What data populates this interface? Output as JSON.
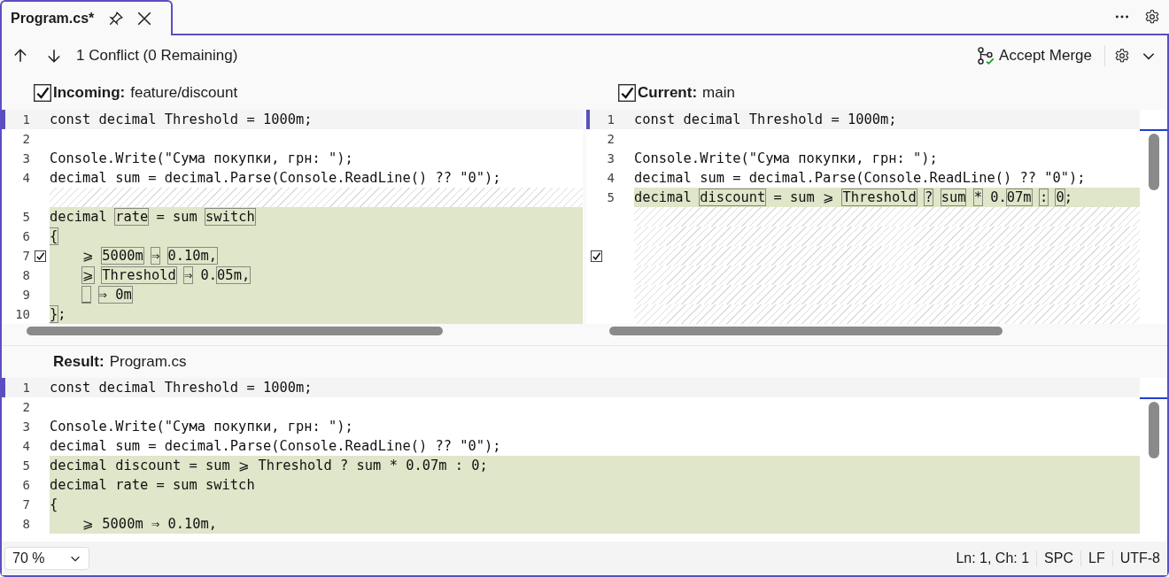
{
  "tab": {
    "title": "Program.cs*"
  },
  "toolbar": {
    "status": "1 Conflict (0 Remaining)",
    "accept_label": "Accept Merge"
  },
  "incoming": {
    "label": "Incoming:",
    "branch": "feature/discount",
    "checked": true,
    "lines": [
      {
        "kind": "current",
        "num": "1",
        "text": "const decimal Threshold = 1000m;"
      },
      {
        "kind": "plain",
        "num": "2"
      },
      {
        "kind": "plain",
        "num": "3",
        "text": "Console.Write(\"Сума покупки, грн: \");"
      },
      {
        "kind": "plain",
        "num": "4",
        "text": "decimal sum = decimal.Parse(Console.ReadLine() ?? \"0\");"
      },
      {
        "kind": "spacer"
      },
      {
        "kind": "changed",
        "num": "5",
        "segments": [
          {
            "text": "decimal ",
            "boxed": false,
            "space_before": false
          },
          {
            "text": "rate",
            "boxed": true,
            "space_before": false
          },
          {
            "text": " = sum ",
            "boxed": false,
            "space_before": false
          },
          {
            "text": "switch",
            "boxed": true,
            "space_before": false
          }
        ]
      },
      {
        "kind": "changed",
        "num": "6",
        "segments": [
          {
            "text": "{",
            "boxed": true,
            "space_before": false
          }
        ]
      },
      {
        "kind": "changed",
        "num": "7",
        "checkbox": {
          "checked": true
        },
        "segments": [
          {
            "text": "    ⩾ ",
            "boxed": false,
            "space_before": false
          },
          {
            "text": "5000m",
            "boxed": true,
            "space_before": false
          },
          {
            "text": "⇒",
            "boxed": true,
            "space_before": true
          },
          {
            "text": "0.10m,",
            "boxed": true,
            "space_before": true
          }
        ]
      },
      {
        "kind": "changed",
        "num": "8",
        "indented": true,
        "segments": [
          {
            "text": "⩾",
            "boxed": true,
            "space_before": false
          },
          {
            "text": "Threshold",
            "boxed": true,
            "space_before": true
          },
          {
            "text": "⇒",
            "boxed": true,
            "space_before": true
          },
          {
            "text": " 0.",
            "boxed": false,
            "space_before": false
          },
          {
            "text": "05m,",
            "boxed": true,
            "space_before": false
          }
        ]
      },
      {
        "kind": "changed",
        "num": "9",
        "indented": true,
        "segments": [
          {
            "text": "_",
            "boxed": true,
            "space_before": false
          },
          {
            "text": "⇒ 0m",
            "boxed": true,
            "space_before": true
          }
        ]
      },
      {
        "kind": "changed",
        "num": "10",
        "segments": [
          {
            "text": "}",
            "boxed": true,
            "space_before": false
          },
          {
            "text": ";",
            "boxed": false,
            "space_before": false
          }
        ]
      }
    ]
  },
  "current": {
    "label": "Current:",
    "branch": "main",
    "checked": true,
    "lines": [
      {
        "kind": "current",
        "num": "1",
        "text": "const decimal Threshold = 1000m;"
      },
      {
        "kind": "plain",
        "num": "2"
      },
      {
        "kind": "plain",
        "num": "3",
        "text": "Console.Write(\"Сума покупки, грн: \");"
      },
      {
        "kind": "plain",
        "num": "4",
        "text": "decimal sum = decimal.Parse(Console.ReadLine() ?? \"0\");"
      },
      {
        "kind": "changed",
        "num": "5",
        "segments": [
          {
            "text": "decimal ",
            "boxed": false,
            "space_before": false
          },
          {
            "text": "discount",
            "boxed": true,
            "space_before": false
          },
          {
            "text": " = sum ⩾ ",
            "boxed": false,
            "space_before": false
          },
          {
            "text": "Threshold",
            "boxed": true,
            "space_before": false
          },
          {
            "text": "?",
            "boxed": true,
            "space_before": true
          },
          {
            "text": "sum",
            "boxed": true,
            "space_before": true
          },
          {
            "text": "*",
            "boxed": true,
            "space_before": true
          },
          {
            "text": " 0.",
            "boxed": false,
            "space_before": false
          },
          {
            "text": "07m",
            "boxed": true,
            "space_before": false
          },
          {
            "text": ":",
            "boxed": true,
            "space_before": true
          },
          {
            "text": "0",
            "boxed": true,
            "space_before": true
          },
          {
            "text": ";",
            "boxed": false,
            "space_before": false
          }
        ]
      },
      {
        "kind": "spacer"
      },
      {
        "kind": "spacer"
      },
      {
        "kind": "spacer",
        "checkbox": {
          "checked": true
        }
      },
      {
        "kind": "spacer"
      },
      {
        "kind": "spacer"
      },
      {
        "kind": "spacer"
      }
    ]
  },
  "result": {
    "label": "Result:",
    "file": "Program.cs",
    "lines": [
      {
        "kind": "current",
        "num": "1",
        "text": "const decimal Threshold = 1000m;"
      },
      {
        "kind": "plain",
        "num": "2"
      },
      {
        "kind": "plain",
        "num": "3",
        "text": "Console.Write(\"Сума покупки, грн: \");"
      },
      {
        "kind": "plain",
        "num": "4",
        "text": "decimal sum = decimal.Parse(Console.ReadLine() ?? \"0\");"
      },
      {
        "kind": "changed",
        "num": "5",
        "text": "decimal discount = sum ⩾ Threshold ? sum * 0.07m : 0;"
      },
      {
        "kind": "changed",
        "num": "6",
        "text": "decimal rate = sum switch"
      },
      {
        "kind": "changed",
        "num": "7",
        "text": "{"
      },
      {
        "kind": "changed",
        "num": "8",
        "text": "    ⩾ 5000m ⇒ 0.10m,"
      }
    ]
  },
  "status_bar": {
    "zoom": "70 %",
    "position": "Ln: 1, Ch: 1",
    "indent": "SPC",
    "line_ending": "LF",
    "encoding": "UTF-8"
  }
}
